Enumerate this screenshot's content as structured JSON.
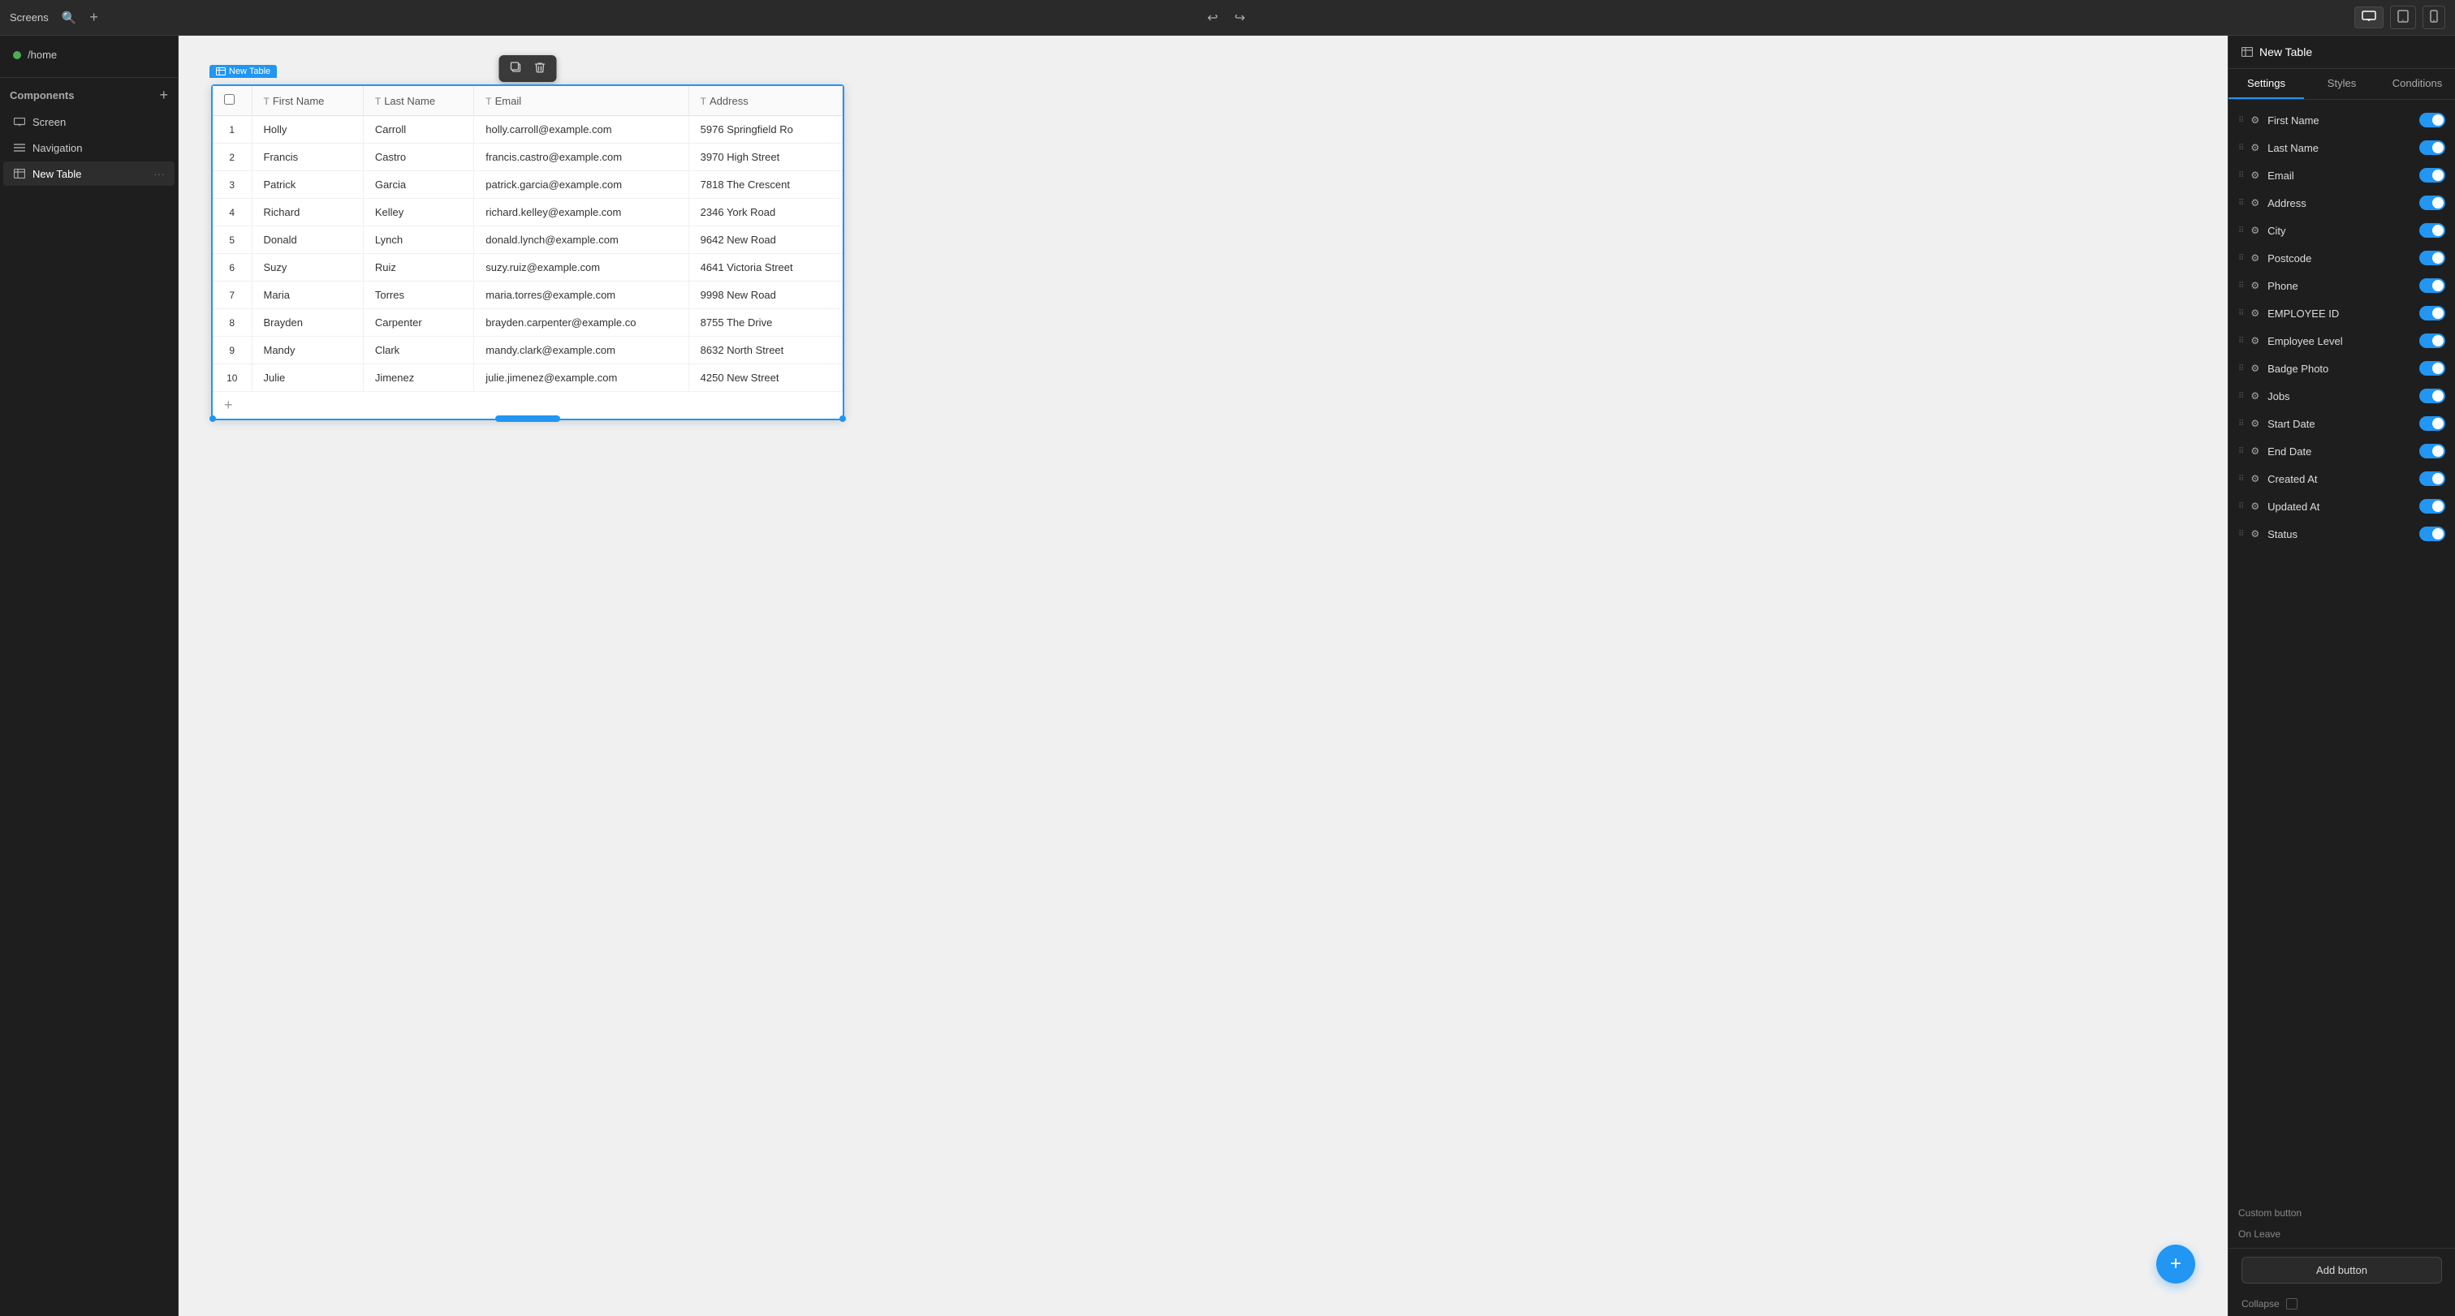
{
  "topbar": {
    "screens_label": "Screens",
    "undo_icon": "↩",
    "redo_icon": "↪",
    "view_desktop": "⬜",
    "view_tablet": "⬜",
    "view_mobile": "📱"
  },
  "sidebar": {
    "screens_label": "Screens",
    "home_item": "/home",
    "components_label": "Components",
    "items": [
      {
        "label": "Screen",
        "icon": "screen"
      },
      {
        "label": "Navigation",
        "icon": "nav"
      },
      {
        "label": "New Table",
        "icon": "table"
      }
    ]
  },
  "canvas": {
    "table_label": "New Table",
    "add_row_icon": "+",
    "fab_icon": "+"
  },
  "table": {
    "columns": [
      {
        "label": "First Name",
        "icon": "T"
      },
      {
        "label": "Last Name",
        "icon": "T"
      },
      {
        "label": "Email",
        "icon": "T"
      },
      {
        "label": "Address",
        "icon": "T"
      }
    ],
    "rows": [
      {
        "num": "1",
        "first": "Holly",
        "last": "Carroll",
        "email": "holly.carroll@example.com",
        "address": "5976 Springfield Ro"
      },
      {
        "num": "2",
        "first": "Francis",
        "last": "Castro",
        "email": "francis.castro@example.com",
        "address": "3970 High Street"
      },
      {
        "num": "3",
        "first": "Patrick",
        "last": "Garcia",
        "email": "patrick.garcia@example.com",
        "address": "7818 The Crescent"
      },
      {
        "num": "4",
        "first": "Richard",
        "last": "Kelley",
        "email": "richard.kelley@example.com",
        "address": "2346 York Road"
      },
      {
        "num": "5",
        "first": "Donald",
        "last": "Lynch",
        "email": "donald.lynch@example.com",
        "address": "9642 New Road"
      },
      {
        "num": "6",
        "first": "Suzy",
        "last": "Ruiz",
        "email": "suzy.ruiz@example.com",
        "address": "4641 Victoria Street"
      },
      {
        "num": "7",
        "first": "Maria",
        "last": "Torres",
        "email": "maria.torres@example.com",
        "address": "9998 New Road"
      },
      {
        "num": "8",
        "first": "Brayden",
        "last": "Carpenter",
        "email": "brayden.carpenter@example.co",
        "address": "8755 The Drive"
      },
      {
        "num": "9",
        "first": "Mandy",
        "last": "Clark",
        "email": "mandy.clark@example.com",
        "address": "8632 North Street"
      },
      {
        "num": "10",
        "first": "Julie",
        "last": "Jimenez",
        "email": "julie.jimenez@example.com",
        "address": "4250 New Street"
      }
    ]
  },
  "right_panel": {
    "title": "New Table",
    "tabs": [
      "Settings",
      "Styles",
      "Conditions"
    ],
    "fields": [
      {
        "label": "First Name",
        "enabled": true
      },
      {
        "label": "Last Name",
        "enabled": true
      },
      {
        "label": "Email",
        "enabled": true
      },
      {
        "label": "Address",
        "enabled": true
      },
      {
        "label": "City",
        "enabled": true
      },
      {
        "label": "Postcode",
        "enabled": true
      },
      {
        "label": "Phone",
        "enabled": true
      },
      {
        "label": "EMPLOYEE ID",
        "enabled": true
      },
      {
        "label": "Employee Level",
        "enabled": true
      },
      {
        "label": "Badge Photo",
        "enabled": true
      },
      {
        "label": "Jobs",
        "enabled": true
      },
      {
        "label": "Start Date",
        "enabled": true
      },
      {
        "label": "End Date",
        "enabled": true
      },
      {
        "label": "Created At",
        "enabled": true
      },
      {
        "label": "Updated At",
        "enabled": true
      },
      {
        "label": "Status",
        "enabled": true
      }
    ],
    "custom_button_label": "Custom button",
    "on_leave_label": "On Leave",
    "add_button_label": "Add button",
    "collapse_label": "Collapse"
  }
}
